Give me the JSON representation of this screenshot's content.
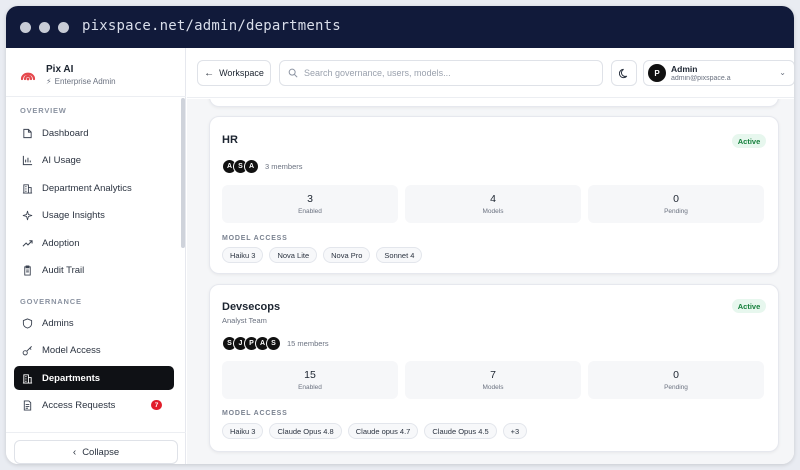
{
  "browser": {
    "url": "pixspace.net/admin/departments"
  },
  "sidebar": {
    "brand_name": "Pix AI",
    "brand_sub": "Enterprise Admin",
    "sections": {
      "overview": "OVERVIEW",
      "governance": "GOVERNANCE"
    },
    "overview_items": [
      {
        "label": "Dashboard"
      },
      {
        "label": "AI Usage"
      },
      {
        "label": "Department Analytics"
      },
      {
        "label": "Usage Insights"
      },
      {
        "label": "Adoption"
      },
      {
        "label": "Audit Trail"
      }
    ],
    "governance_items": [
      {
        "label": "Admins"
      },
      {
        "label": "Model Access"
      },
      {
        "label": "Departments"
      },
      {
        "label": "Access Requests",
        "badge": "7"
      }
    ],
    "collapse_label": "Collapse"
  },
  "topbar": {
    "workspace_label": "Workspace",
    "search_placeholder": "Search governance, users, models...",
    "user_initial": "P",
    "user_name": "Admin",
    "user_email": "admin@pixspace.a"
  },
  "departments": [
    {
      "name": "HR",
      "subtitle": "",
      "status": "Active",
      "avatars": [
        "A",
        "S",
        "A"
      ],
      "member_count": "3 members",
      "stats": [
        {
          "value": "3",
          "label": "Enabled"
        },
        {
          "value": "4",
          "label": "Models"
        },
        {
          "value": "0",
          "label": "Pending"
        }
      ],
      "model_access_label": "MODEL ACCESS",
      "models": [
        "Haiku 3",
        "Nova Lite",
        "Nova Pro",
        "Sonnet 4"
      ]
    },
    {
      "name": "Devsecops",
      "subtitle": "Analyst Team",
      "status": "Active",
      "avatars": [
        "S",
        "J",
        "P",
        "A",
        "S"
      ],
      "member_count": "15 members",
      "stats": [
        {
          "value": "15",
          "label": "Enabled"
        },
        {
          "value": "7",
          "label": "Models"
        },
        {
          "value": "0",
          "label": "Pending"
        }
      ],
      "model_access_label": "MODEL ACCESS",
      "models": [
        "Haiku 3",
        "Claude Opus 4.8",
        "Claude opus 4.7",
        "Claude Opus 4.5",
        "+3"
      ]
    }
  ],
  "colors": {
    "titlebar": "#111a3a",
    "active_nav": "#0f1115",
    "badge": "#e11d2a",
    "status_bg": "#e7f7ee",
    "status_text": "#16803c"
  }
}
